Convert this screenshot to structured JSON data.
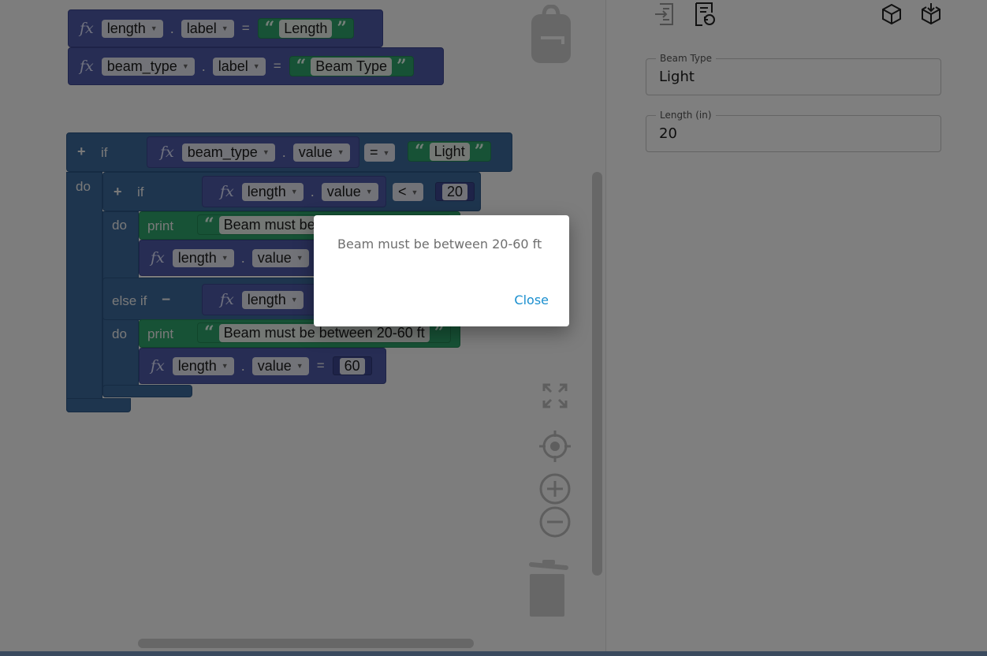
{
  "blocks": {
    "label_length": {
      "var": "length",
      "prop": "label",
      "op": "=",
      "text": "Length"
    },
    "label_beam": {
      "var": "beam_type",
      "prop": "label",
      "op": "=",
      "text": "Beam Type"
    },
    "if_outer": {
      "kw_if": "if",
      "kw_do": "do",
      "var": "beam_type",
      "prop": "value",
      "op": "=",
      "text": "Light"
    },
    "if_inner": {
      "kw_if": "if",
      "kw_do": "do",
      "var": "length",
      "prop": "value",
      "op": "<",
      "num": "20"
    },
    "print1": {
      "kw": "print",
      "text": "Beam must be between 20-60 ft",
      "var": "length",
      "prop": "value"
    },
    "elseif": {
      "kw": "else if",
      "minus": "−",
      "var": "length"
    },
    "print2": {
      "kw": "print",
      "kw_do": "do",
      "text": "Beam must be between 20-60 ft",
      "var": "length",
      "prop": "value",
      "op": "=",
      "num": "60"
    }
  },
  "fx_symbol": "fx",
  "dot": ".",
  "plus": "+",
  "quote_open": "“",
  "quote_close": "”",
  "form": {
    "beam_type": {
      "label": "Beam Type",
      "value": "Light"
    },
    "length": {
      "label": "Length (in)",
      "value": "20"
    }
  },
  "dialog": {
    "message": "Beam must be between 20-60 ft",
    "close_label": "Close"
  },
  "colors": {
    "variable": "#4f5ba8",
    "text": "#2fa46c",
    "control": "#3d6a9c",
    "link": "#1a8fcf"
  }
}
